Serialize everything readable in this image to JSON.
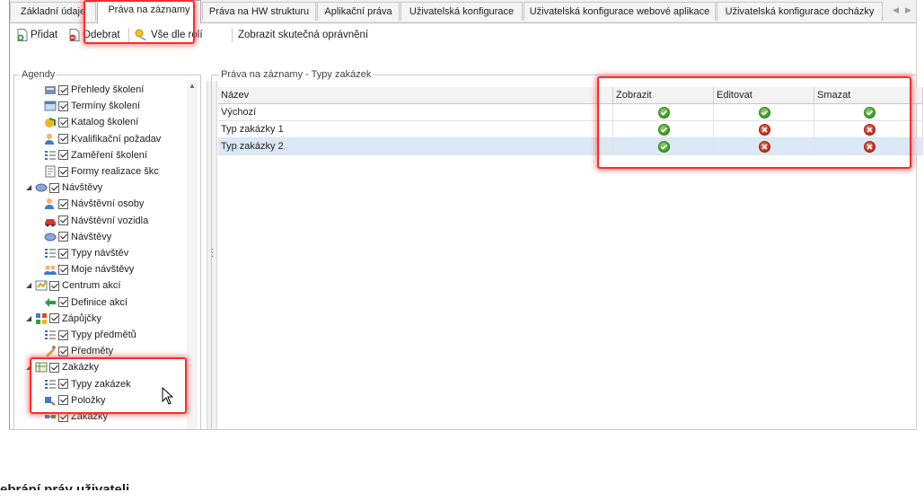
{
  "tabs": [
    {
      "label": "Základní údaje"
    },
    {
      "label": "Práva na záznamy"
    },
    {
      "label": "Práva na HW strukturu"
    },
    {
      "label": "Aplikační práva"
    },
    {
      "label": "Uživatelská konfigurace"
    },
    {
      "label": "Uživatelská konfigurace webové aplikace"
    },
    {
      "label": "Uživatelská konfigurace docházky"
    }
  ],
  "active_tab": "Práva na záznamy",
  "toolbar": {
    "add_label": "Přidat",
    "remove_label": "Odebrat",
    "all_by_roles_label": "Vše dle rolí",
    "show_effective_label": "Zobrazit skutečná oprávnění"
  },
  "agendas": {
    "title": "Agendy",
    "items": [
      {
        "label": "Přehledy školení",
        "icon": "report-icon",
        "level": 1,
        "checked": true
      },
      {
        "label": "Termíny školení",
        "icon": "calendar-icon",
        "level": 1,
        "checked": true
      },
      {
        "label": "Katalog školení",
        "icon": "catalog-icon",
        "level": 1,
        "checked": true
      },
      {
        "label": "Kvalifikační požadav",
        "icon": "person-icon",
        "level": 1,
        "checked": true
      },
      {
        "label": "Zaměření školení",
        "icon": "list-icon",
        "level": 1,
        "checked": true
      },
      {
        "label": "Formy realizace škc",
        "icon": "form-icon",
        "level": 1,
        "checked": true
      },
      {
        "label": "Návštěvy",
        "icon": "book-icon",
        "level": 0,
        "checked": true
      },
      {
        "label": "Návštěvní osoby",
        "icon": "person-icon",
        "level": 1,
        "checked": true
      },
      {
        "label": "Návštěvní vozidla",
        "icon": "car-icon",
        "level": 1,
        "checked": true
      },
      {
        "label": "Návštěvy",
        "icon": "book-icon",
        "level": 1,
        "checked": true
      },
      {
        "label": "Typy návštěv",
        "icon": "list-icon",
        "level": 1,
        "checked": true
      },
      {
        "label": "Moje návštěvy",
        "icon": "people-icon",
        "level": 1,
        "checked": true
      },
      {
        "label": "Centrum akcí",
        "icon": "action-center-icon",
        "level": 0,
        "checked": true
      },
      {
        "label": "Definice akcí",
        "icon": "arrows-icon",
        "level": 1,
        "checked": true
      },
      {
        "label": "Zápůjčky",
        "icon": "loan-icon",
        "level": 0,
        "checked": true
      },
      {
        "label": "Typy předmětů",
        "icon": "list-icon",
        "level": 1,
        "checked": true
      },
      {
        "label": "Předměty",
        "icon": "tools-icon",
        "level": 1,
        "checked": true
      },
      {
        "label": "Zakázky",
        "icon": "order-icon",
        "level": 0,
        "checked": true
      },
      {
        "label": "Typy zakázek",
        "icon": "list-icon",
        "level": 1,
        "checked": true
      },
      {
        "label": "Položky",
        "icon": "items-icon",
        "level": 1,
        "checked": true
      },
      {
        "label": "Zakázky",
        "icon": "order-link-icon",
        "level": 1,
        "checked": true
      }
    ]
  },
  "rights": {
    "title": "Práva na záznamy - Typy zakázek",
    "columns": [
      "Název",
      "Zobrazit",
      "Editovat",
      "Smazat"
    ],
    "rows": [
      {
        "name": "Výchozí",
        "view": true,
        "edit": true,
        "delete": true
      },
      {
        "name": "Typ zakázky 1",
        "view": true,
        "edit": false,
        "delete": false
      },
      {
        "name": "Typ zakázky 2",
        "view": true,
        "edit": false,
        "delete": false
      }
    ]
  },
  "caption": "ebrání práv uživateli",
  "colors": {
    "highlight": "#ff2a2a",
    "selected_row": "#dbe9f6",
    "allowed": "#3c9a25",
    "denied": "#c42a1a"
  }
}
